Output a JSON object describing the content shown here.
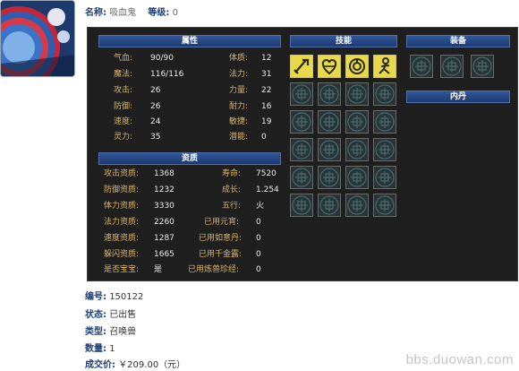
{
  "header": {
    "name_label": "名称:",
    "name_value": "吸血鬼",
    "level_label": "等级:",
    "level_value": "0"
  },
  "sections": {
    "attributes": "属性",
    "aptitude": "资质",
    "skills": "技能",
    "equipment": "装备",
    "inner_elixir": "内丹"
  },
  "attributes": {
    "left": [
      {
        "k": "气血:",
        "v": "90/90"
      },
      {
        "k": "魔法:",
        "v": "116/116"
      },
      {
        "k": "攻击:",
        "v": "26"
      },
      {
        "k": "防御:",
        "v": "26"
      },
      {
        "k": "速度:",
        "v": "24"
      },
      {
        "k": "灵力:",
        "v": "35"
      }
    ],
    "right": [
      {
        "k": "体质:",
        "v": "12"
      },
      {
        "k": "法力:",
        "v": "31"
      },
      {
        "k": "力量:",
        "v": "22"
      },
      {
        "k": "耐力:",
        "v": "16"
      },
      {
        "k": "敏捷:",
        "v": "19"
      },
      {
        "k": "潜能:",
        "v": "0"
      }
    ]
  },
  "aptitude": {
    "left": [
      {
        "k": "攻击资质:",
        "v": "1368"
      },
      {
        "k": "防御资质:",
        "v": "1232"
      },
      {
        "k": "体力资质:",
        "v": "3330"
      },
      {
        "k": "法力资质:",
        "v": "2260"
      },
      {
        "k": "速度资质:",
        "v": "1287"
      },
      {
        "k": "躲闪资质:",
        "v": "1665"
      },
      {
        "k": "是否宝宝:",
        "v": "是"
      }
    ],
    "right": [
      {
        "k": "寿命:",
        "v": "7520"
      },
      {
        "k": "成长:",
        "v": "1.254"
      },
      {
        "k": "五行:",
        "v": "火"
      },
      {
        "k": "已用元宵:",
        "v": "0"
      },
      {
        "k": "已用如意丹:",
        "v": "0"
      },
      {
        "k": "已用千金露:",
        "v": "0"
      },
      {
        "k": "已用炼兽珍经:",
        "v": "0"
      }
    ]
  },
  "skills": [
    "sword-skill-icon",
    "heart-skill-icon",
    "swirl-skill-icon",
    "figure-skill-icon"
  ],
  "info": [
    {
      "k": "编号:",
      "v": "150122"
    },
    {
      "k": "状态:",
      "v": "已出售"
    },
    {
      "k": "类型:",
      "v": "召唤兽"
    },
    {
      "k": "数量:",
      "v": "1"
    },
    {
      "k": "成交价:",
      "v": "￥209.00（元）"
    }
  ],
  "watermark": "bbs.duowan.com",
  "colors": {
    "panel_bg": "#1f1f1f",
    "section_bar": "#2a4b8a",
    "label_gold": "#d7b46a",
    "value_white": "#e9e9e9",
    "slot_teal": "#283436",
    "skill_yellow": "#e8d84a",
    "info_label_blue": "#1d3f7a"
  }
}
